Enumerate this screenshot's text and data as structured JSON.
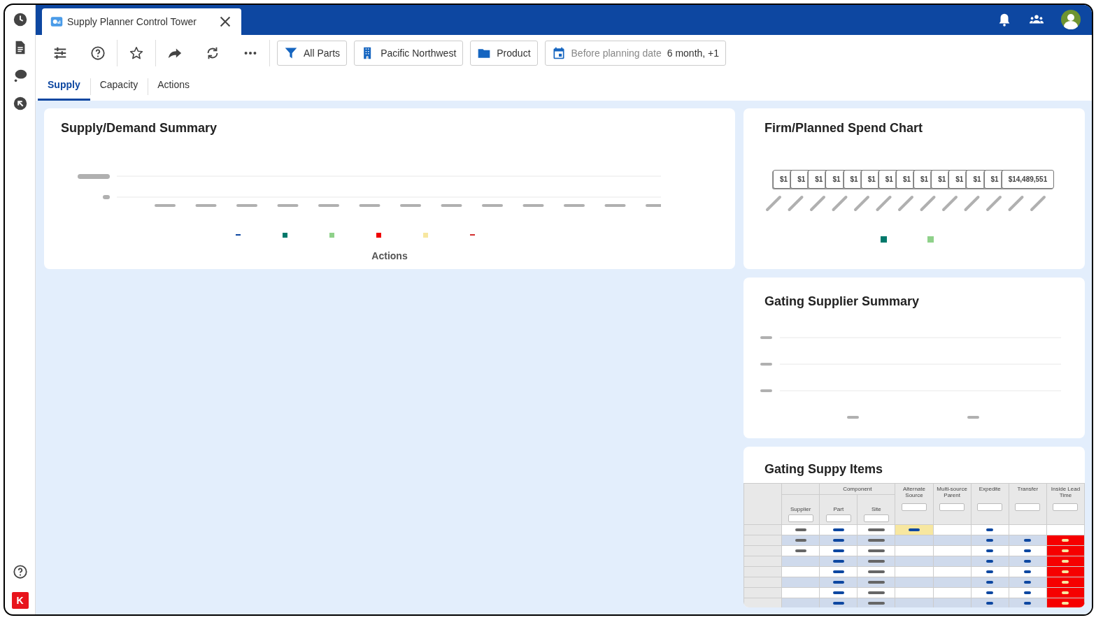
{
  "app_tab": {
    "title": "Supply Planner Control Tower"
  },
  "filters": [
    {
      "label": "All Parts"
    },
    {
      "label": "Pacific Northwest"
    },
    {
      "label": "Product"
    },
    {
      "label": "Before planning date",
      "value": "6 month, +1"
    }
  ],
  "tabs": [
    {
      "label": "Supply",
      "selected": true
    },
    {
      "label": "Capacity",
      "selected": false
    },
    {
      "label": "Actions",
      "selected": false
    }
  ],
  "sidebar": {
    "logo_letter": "K"
  },
  "supply_demand": {
    "title": "Supply/Demand Summary",
    "axis_label": "Actions",
    "legend": [
      {
        "kind": "dash",
        "color": "#0d47a1"
      },
      {
        "kind": "square",
        "color": "#00796b"
      },
      {
        "kind": "square",
        "color": "#8fd18a"
      },
      {
        "kind": "square",
        "color": "#f00000"
      },
      {
        "kind": "square",
        "color": "#f7e7a0"
      },
      {
        "kind": "dash",
        "color": "#d32f2f"
      }
    ]
  },
  "spend_chart": {
    "title": "Firm/Planned Spend Chart",
    "value_labels": [
      "$1",
      "$1",
      "$1",
      "$1",
      "$1",
      "$1",
      "$1",
      "$1",
      "$1",
      "$1",
      "$1",
      "$1",
      "$1",
      "$14,489,551"
    ],
    "legend": [
      {
        "color": "#00796b"
      },
      {
        "color": "#8fd18a"
      }
    ]
  },
  "supplier_summary": {
    "title": "Gating Supplier Summary"
  },
  "items_table": {
    "title": "Gating Suppy Items",
    "group_header": "Component",
    "columns": [
      "Supplier",
      "Part",
      "Site",
      "Alternate Source",
      "Multi-source Parent",
      "Expedite",
      "Transfer",
      "Inside Lead Time"
    ],
    "rows": [
      {
        "cells": [
          {
            "color": "#666666"
          },
          {
            "color": "#0d47a1"
          },
          {
            "color": "#666666"
          },
          {
            "color": "#0d47a1",
            "highlight": {
              "color": "#f7e7a0"
            }
          },
          null,
          {
            "color": "#0d47a1"
          },
          null,
          null
        ]
      },
      {
        "cells": [
          {
            "color": "#666666"
          },
          {
            "color": "#0d47a1"
          },
          {
            "color": "#666666"
          },
          null,
          null,
          {
            "color": "#0d47a1"
          },
          {
            "color": "#0d47a1"
          },
          {
            "color": "#f7e7a0",
            "highlight": {
              "color": "#f60000"
            }
          }
        ]
      },
      {
        "cells": [
          {
            "color": "#666666"
          },
          {
            "color": "#0d47a1"
          },
          {
            "color": "#666666"
          },
          null,
          null,
          {
            "color": "#0d47a1"
          },
          {
            "color": "#0d47a1"
          },
          {
            "color": "#f7e7a0",
            "highlight": {
              "color": "#f60000"
            }
          }
        ]
      },
      {
        "cells": [
          null,
          {
            "color": "#0d47a1"
          },
          {
            "color": "#666666"
          },
          null,
          null,
          {
            "color": "#0d47a1"
          },
          {
            "color": "#0d47a1"
          },
          {
            "color": "#f7e7a0",
            "highlight": {
              "color": "#f60000"
            }
          }
        ]
      },
      {
        "cells": [
          null,
          {
            "color": "#0d47a1"
          },
          {
            "color": "#666666"
          },
          null,
          null,
          {
            "color": "#0d47a1"
          },
          {
            "color": "#0d47a1"
          },
          {
            "color": "#f7e7a0",
            "highlight": {
              "color": "#f60000"
            }
          }
        ]
      },
      {
        "cells": [
          null,
          {
            "color": "#0d47a1"
          },
          {
            "color": "#666666"
          },
          null,
          null,
          {
            "color": "#0d47a1"
          },
          {
            "color": "#0d47a1"
          },
          {
            "color": "#f7e7a0",
            "highlight": {
              "color": "#f60000"
            }
          }
        ]
      },
      {
        "cells": [
          null,
          {
            "color": "#0d47a1"
          },
          {
            "color": "#666666"
          },
          null,
          null,
          {
            "color": "#0d47a1"
          },
          {
            "color": "#0d47a1"
          },
          {
            "color": "#f7e7a0",
            "highlight": {
              "color": "#f60000"
            }
          }
        ]
      },
      {
        "cells": [
          null,
          {
            "color": "#0d47a1"
          },
          {
            "color": "#666666"
          },
          null,
          null,
          {
            "color": "#0d47a1"
          },
          {
            "color": "#0d47a1"
          },
          {
            "color": "#f7e7a0",
            "highlight": {
              "color": "#f60000"
            }
          }
        ]
      }
    ]
  }
}
